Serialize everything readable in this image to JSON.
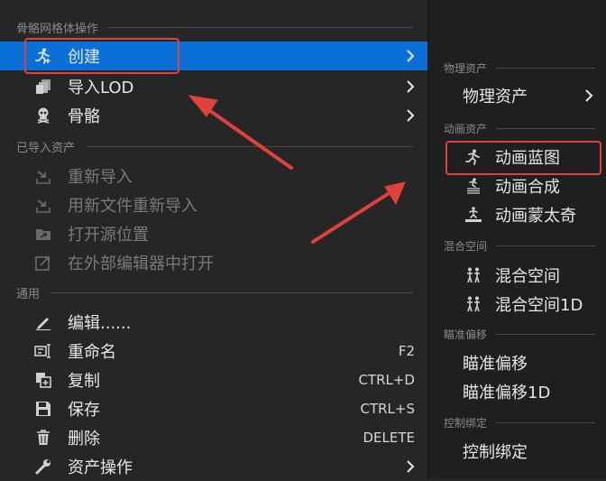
{
  "main_menu": {
    "section_mesh": "骨骼网格体操作",
    "create": "创建",
    "import_lod": "导入LOD",
    "skeleton": "骨骼",
    "section_imported": "已导入资产",
    "reimport": "重新导入",
    "reimport_new_file": "用新文件重新导入",
    "open_source_location": "打开源位置",
    "open_external_editor": "在外部编辑器中打开",
    "section_common": "通用",
    "edit": "编辑......",
    "rename": "重命名",
    "rename_shortcut": "F2",
    "duplicate": "复制",
    "duplicate_shortcut": "CTRL+D",
    "save": "保存",
    "save_shortcut": "CTRL+S",
    "delete": "删除",
    "delete_shortcut": "DELETE",
    "asset_actions": "资产操作"
  },
  "submenu": {
    "section_physics": "物理资产",
    "physics_asset": "物理资产",
    "section_animation": "动画资产",
    "anim_blueprint": "动画蓝图",
    "anim_composite": "动画合成",
    "anim_montage": "动画蒙太奇",
    "section_blendspace": "混合空间",
    "blendspace": "混合空间",
    "blendspace_1d": "混合空间1D",
    "section_aim_offset": "瞄准偏移",
    "aim_offset": "瞄准偏移",
    "aim_offset_1d": "瞄准偏移1D",
    "section_control_rig": "控制绑定",
    "control_rig": "控制绑定"
  },
  "colors": {
    "selection": "#0b6fd8",
    "annotation": "#e0413a",
    "background": "#262626",
    "submenu_background": "#1f1f1f"
  },
  "icons": {
    "create": "running-figure-plus-icon",
    "import_lod": "stacked-layers-icon",
    "skeleton": "skull-icon",
    "reimport": "reimport-arrow-icon",
    "edit": "pencil-icon",
    "rename": "rename-text-icon",
    "duplicate": "duplicate-icon",
    "save": "floppy-disk-icon",
    "delete": "trash-icon",
    "asset_actions": "wrench-icon",
    "submenu_arrow": "chevron-right-icon"
  }
}
